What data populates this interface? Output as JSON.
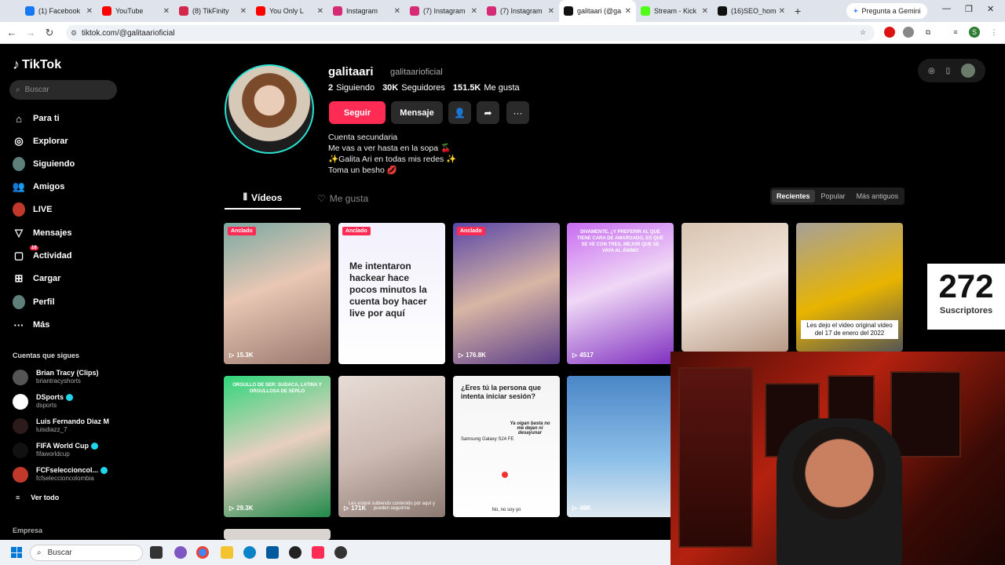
{
  "browser": {
    "tabs": [
      {
        "title": "(1) Facebook",
        "icon": "facebook-icon",
        "color": "#1877f2"
      },
      {
        "title": "YouTube",
        "icon": "youtube-icon",
        "color": "#ff0000"
      },
      {
        "title": "(8) TikFinity",
        "icon": "tikfinity-icon",
        "color": "#d3264b"
      },
      {
        "title": "You Only L",
        "icon": "speaker-icon",
        "color": "#ff0000"
      },
      {
        "title": "Instagram",
        "icon": "instagram-icon",
        "color": "#d62976"
      },
      {
        "title": "(7) Instagram",
        "icon": "instagram-icon",
        "color": "#d62976"
      },
      {
        "title": "(7) Instagram",
        "icon": "instagram-icon",
        "color": "#d62976"
      },
      {
        "title": "galitaari (@ga",
        "icon": "tiktok-icon",
        "color": "#111111"
      },
      {
        "title": "Stream - Kick",
        "icon": "kick-icon",
        "color": "#53fc18"
      },
      {
        "title": "(16)SEO_home",
        "icon": "tiktok-icon",
        "color": "#111111"
      }
    ],
    "gemini_label": "Pregunta a Gemini",
    "url": "tiktok.com/@galitaarioficial"
  },
  "sidebar": {
    "logo": "TikTok",
    "search_placeholder": "Buscar",
    "nav": [
      {
        "label": "Para ti",
        "icon": "home-icon"
      },
      {
        "label": "Explorar",
        "icon": "compass-icon"
      },
      {
        "label": "Siguiendo",
        "icon": "following-avatar-icon"
      },
      {
        "label": "Amigos",
        "icon": "friends-icon"
      },
      {
        "label": "LIVE",
        "icon": "live-avatar-icon"
      },
      {
        "label": "Mensajes",
        "icon": "messages-icon"
      },
      {
        "label": "Actividad",
        "icon": "activity-icon",
        "badge": "16"
      },
      {
        "label": "Cargar",
        "icon": "upload-icon"
      },
      {
        "label": "Perfil",
        "icon": "profile-avatar-icon"
      },
      {
        "label": "Más",
        "icon": "more-icon"
      }
    ],
    "following_header": "Cuentas que sigues",
    "accounts": [
      {
        "name": "Brian Tracy (Clips)",
        "handle": "briantracyshorts",
        "verified": false
      },
      {
        "name": "DSports",
        "handle": "dsports",
        "verified": true
      },
      {
        "name": "Luis Fernando Diaz M",
        "handle": "luisdiazz_7",
        "verified": false
      },
      {
        "name": "FIFA World Cup",
        "handle": "fifaworldcup",
        "verified": true
      },
      {
        "name": "FCFseleccioncol...",
        "handle": "fcfseleccioncolombia",
        "verified": true
      }
    ],
    "see_all": "Ver todo",
    "footer_section": "Empresa"
  },
  "profile": {
    "name": "galitaari",
    "handle": "galitaarioficial",
    "following_count": "2",
    "following_label": "Siguiendo",
    "followers_count": "30K",
    "followers_label": "Seguidores",
    "likes_count": "151.5K",
    "likes_label": "Me gusta",
    "follow_button": "Seguir",
    "message_button": "Mensaje",
    "bio": [
      "Cuenta secundaria",
      "Me vas a ver hasta en la sopa 🍒",
      "✨Galita Ari en todas mis redes ✨",
      "Toma un besho 💋"
    ]
  },
  "tabs": {
    "videos": "Vídeos",
    "likes": "Me gusta"
  },
  "sort": [
    "Recientes",
    "Popular",
    "Más antiguos"
  ],
  "videos": [
    {
      "views": "15.3K",
      "pinned": true
    },
    {
      "views": "157.5K",
      "pinned": true,
      "text": "Me intentaron hackear hace pocos minutos la cuenta boy hacer live por aquí"
    },
    {
      "views": "176.8K",
      "pinned": true
    },
    {
      "views": "4517",
      "pinned": false,
      "overlay": "DIVAMENTE, ¿Y PREFERIR AL QUE TIENE CARA DE AMARGADO, ES QUE SE VE CON TRES, MEJOR QUE SE VAYA AL ÁNIMO"
    },
    {
      "views": "",
      "pinned": false
    },
    {
      "views": "",
      "pinned": false,
      "caption": "Les dejo el video original video del 17 de enero del 2022"
    },
    {
      "views": "29.3K",
      "pinned": false,
      "overlay": "ORGULLO DE SER: SUDACA, LATINA Y ORGULLOSA DE SERLO"
    },
    {
      "views": "171K",
      "pinned": false,
      "caption2": "Les estaré subiendo contenido por aquí y pueden seguirme"
    },
    {
      "views": "8.3K",
      "pinned": false,
      "question": "¿Eres tú la persona que intenta iniciar sesión?",
      "device": "Samsung Galaxy S24 FE",
      "reply": "Ya oigan basta no me dejan ni desayunar",
      "footer": "No, no soy yo"
    },
    {
      "views": "48K",
      "pinned": false
    }
  ],
  "overlay": {
    "subscribers_count": "272",
    "subscribers_label": "Suscriptores"
  },
  "taskbar": {
    "search_placeholder": "Buscar"
  }
}
